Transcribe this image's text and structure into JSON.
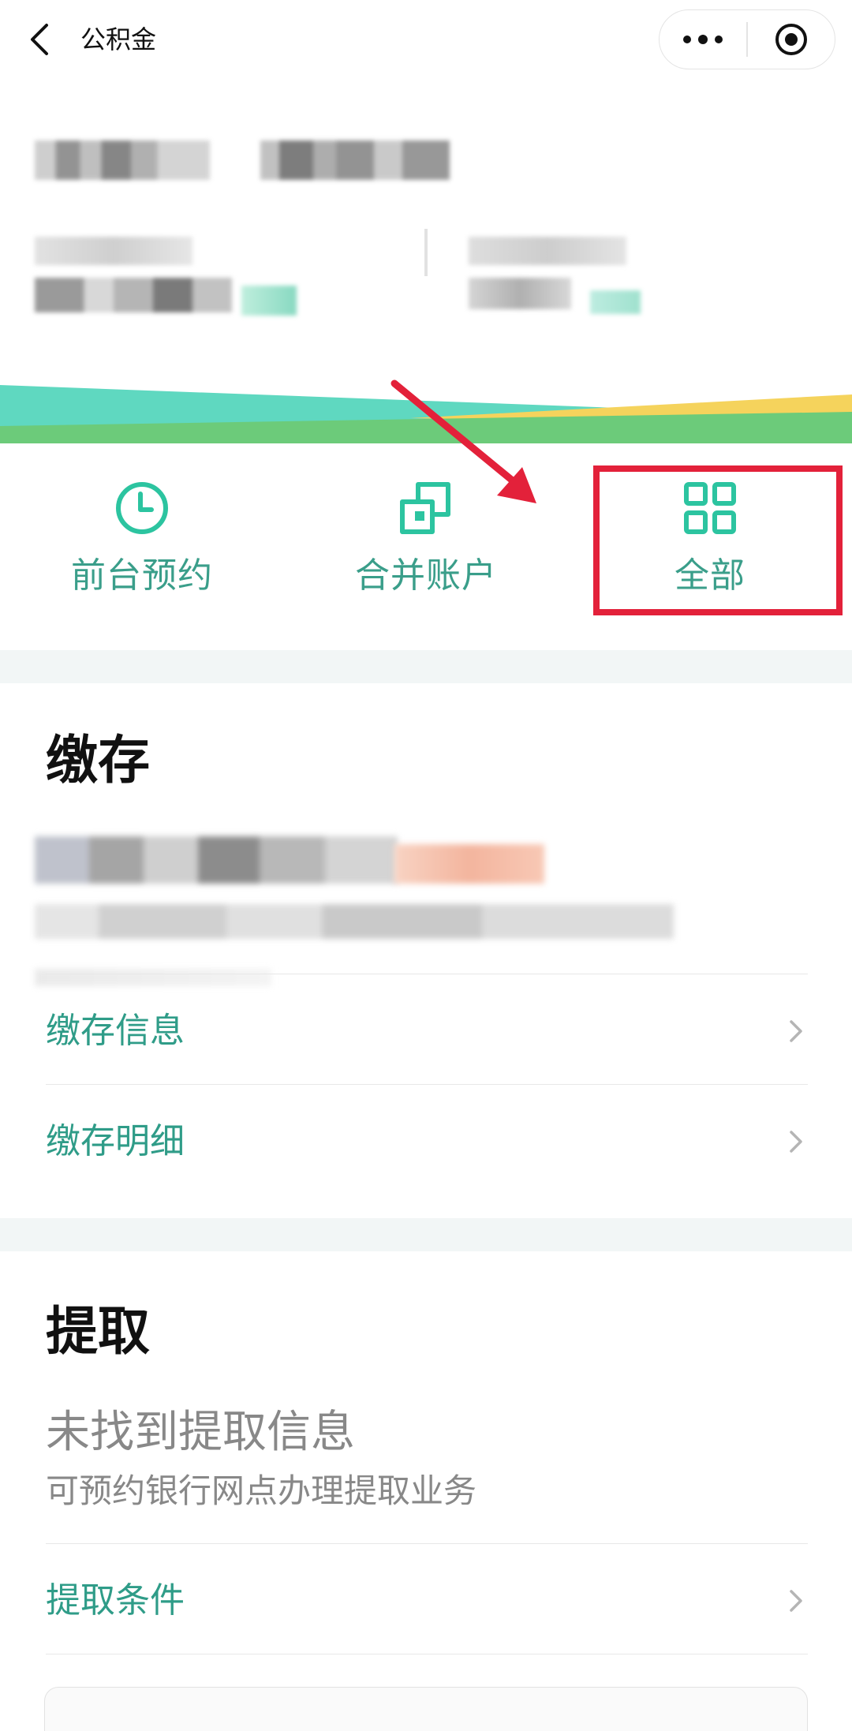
{
  "navbar": {
    "title": "公积金",
    "back_icon": "chevron-left-icon",
    "more_icon": "more-dots-icon",
    "close_icon": "target-circle-icon"
  },
  "actions": [
    {
      "label": "前台预约",
      "icon": "clock-icon"
    },
    {
      "label": "合并账户",
      "icon": "merge-squares-icon"
    },
    {
      "label": "全部",
      "icon": "grid-icon"
    }
  ],
  "deposit": {
    "title": "缴存",
    "rows": [
      {
        "label": "缴存信息"
      },
      {
        "label": "缴存明细"
      }
    ]
  },
  "withdraw": {
    "title": "提取",
    "empty_title": "未找到提取信息",
    "empty_sub": "可预约银行网点办理提取业务",
    "rows": [
      {
        "label": "提取条件"
      }
    ]
  },
  "colors": {
    "accent": "#2f9c88",
    "highlight": "#e3213a",
    "wave_teal": "#5fd8c0",
    "wave_green": "#6ccb7a",
    "wave_yellow": "#f5d35c"
  }
}
